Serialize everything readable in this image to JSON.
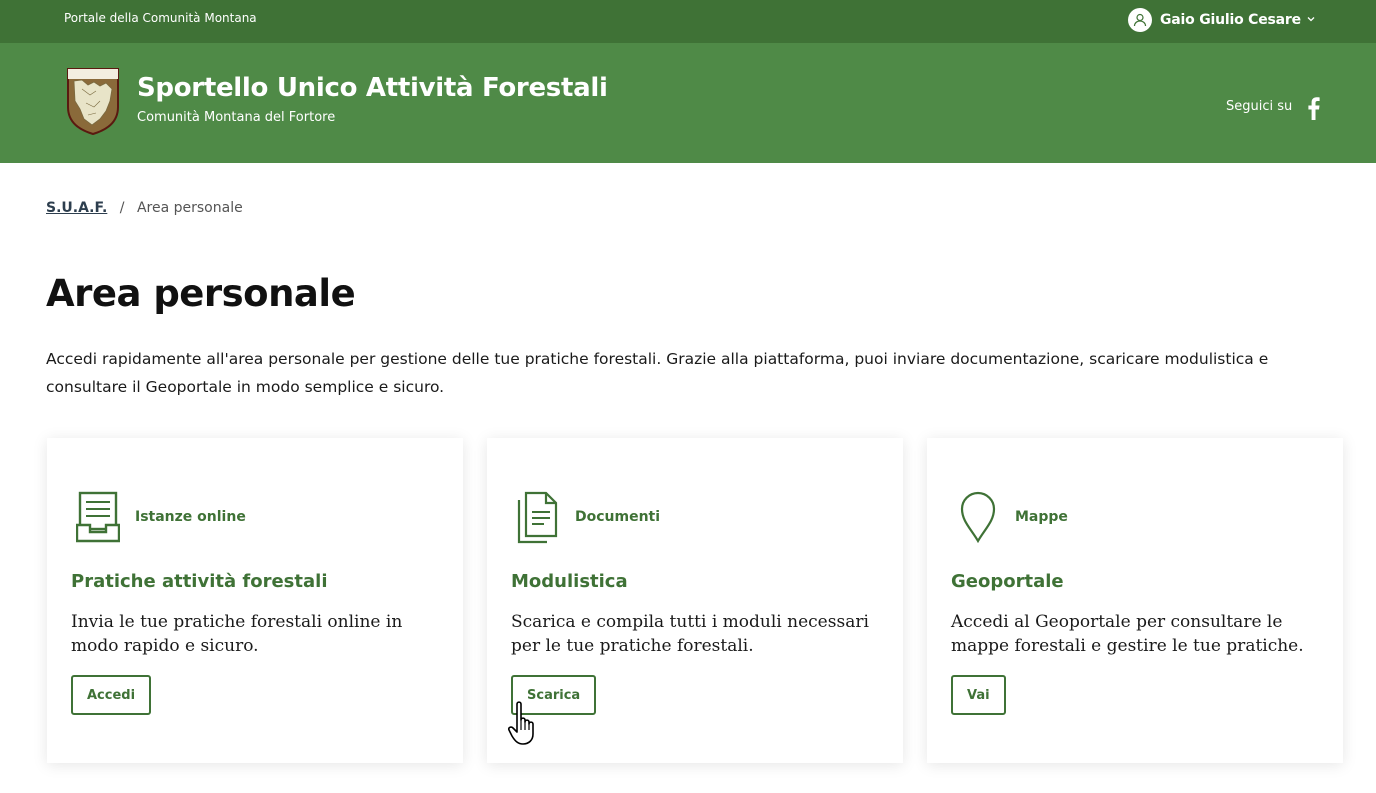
{
  "slim_header": {
    "title": "Portale della Comunità Montana",
    "user_name": "Gaio Giulio Cesare"
  },
  "header": {
    "title": "Sportello Unico Attività Forestali",
    "subtitle": "Comunità Montana del Fortore",
    "follow_label": "Seguici su",
    "logo_text": "COMUNITÀ MONTANA DEL FORTORE"
  },
  "breadcrumb": {
    "home": "S.U.A.F.",
    "separator": "/",
    "current": "Area personale"
  },
  "page": {
    "title": "Area personale",
    "intro": "Accedi rapidamente all'area personale per gestione delle tue pratiche forestali. Grazie alla piattaforma, puoi inviare documentazione, scaricare modulistica e consultare il Geoportale in modo semplice e sicuro."
  },
  "cards": [
    {
      "icon": "inbox-form-icon",
      "category": "Istanze online",
      "title": "Pratiche attività forestali",
      "text": "Invia le tue pratiche forestali online in modo rapido e sicuro.",
      "button": "Accedi"
    },
    {
      "icon": "documents-icon",
      "category": "Documenti",
      "title": "Modulistica",
      "text": "Scarica e compila tutti i moduli necessari per le tue pratiche forestali.",
      "button": "Scarica"
    },
    {
      "icon": "map-pin-icon",
      "category": "Mappe",
      "title": "Geoportale",
      "text": "Accedi al Geoportale per consultare le mappe forestali e gestire le tue pratiche.",
      "button": "Vai"
    }
  ],
  "colors": {
    "slim_header_bg": "#3f7236",
    "header_bg": "#4f8a47",
    "accent": "#3f7236"
  }
}
